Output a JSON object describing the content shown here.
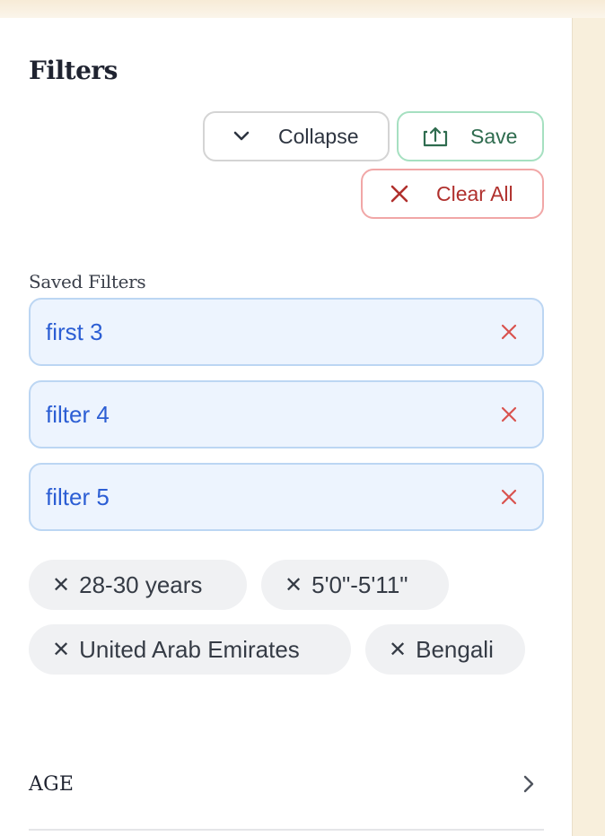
{
  "panel": {
    "title": "Filters",
    "actions": {
      "collapse_label": "Collapse",
      "save_label": "Save",
      "clear_all_label": "Clear All"
    },
    "saved_filters": {
      "label": "Saved Filters",
      "items": [
        {
          "name": "first 3"
        },
        {
          "name": "filter 4"
        },
        {
          "name": "filter 5"
        }
      ]
    },
    "active_chips": [
      {
        "label": "28-30 years"
      },
      {
        "label": "5'0\"-5'11\""
      },
      {
        "label": "United Arab Emirates"
      },
      {
        "label": "Bengali"
      }
    ],
    "sections": [
      {
        "label": "AGE"
      }
    ]
  },
  "icons": {
    "collapse": "chevron-down-icon",
    "save": "upload-icon",
    "clear": "close-icon",
    "remove_saved": "close-icon",
    "remove_chip": "close-icon",
    "section": "chevron-right-icon"
  },
  "colors": {
    "page_bg": "#f8efdc",
    "save_accent": "#2f6c4f",
    "clear_accent": "#b0302d",
    "saved_text": "#2c5ed4",
    "saved_bg": "#edf4fe",
    "remove_x": "#d9534f"
  }
}
